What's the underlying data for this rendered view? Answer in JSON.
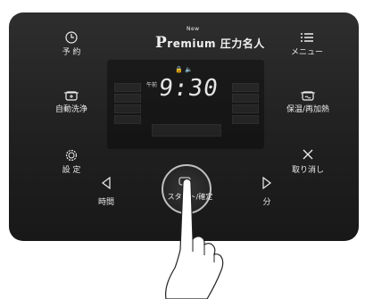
{
  "brand": {
    "prefix": "P",
    "name": "remium",
    "new_badge": "New",
    "product": "圧力名人"
  },
  "buttons": {
    "reservation": {
      "label": "予 約",
      "icon": "clock-icon"
    },
    "menu": {
      "label": "メニュー",
      "icon": "list-icon"
    },
    "auto_wash": {
      "label": "自動洗浄",
      "icon": "pot-wash-icon"
    },
    "keep_warm": {
      "label": "保温/再加熱",
      "icon": "pot-warm-icon"
    },
    "settings": {
      "label": "設 定",
      "icon": "gear-icon"
    },
    "cancel": {
      "label": "取り消し",
      "icon": "x-icon"
    },
    "hour": {
      "label": "時間",
      "icon": "left-triangle-icon"
    },
    "minute": {
      "label": "分",
      "icon": "right-triangle-icon"
    },
    "start": {
      "label": "スタート/確定",
      "icon": "start-icon"
    }
  },
  "display": {
    "time": "9:30",
    "am_label": "午前",
    "status_icons": "🔒 🔈"
  },
  "hand": {
    "icon": "pointing-hand-icon"
  }
}
